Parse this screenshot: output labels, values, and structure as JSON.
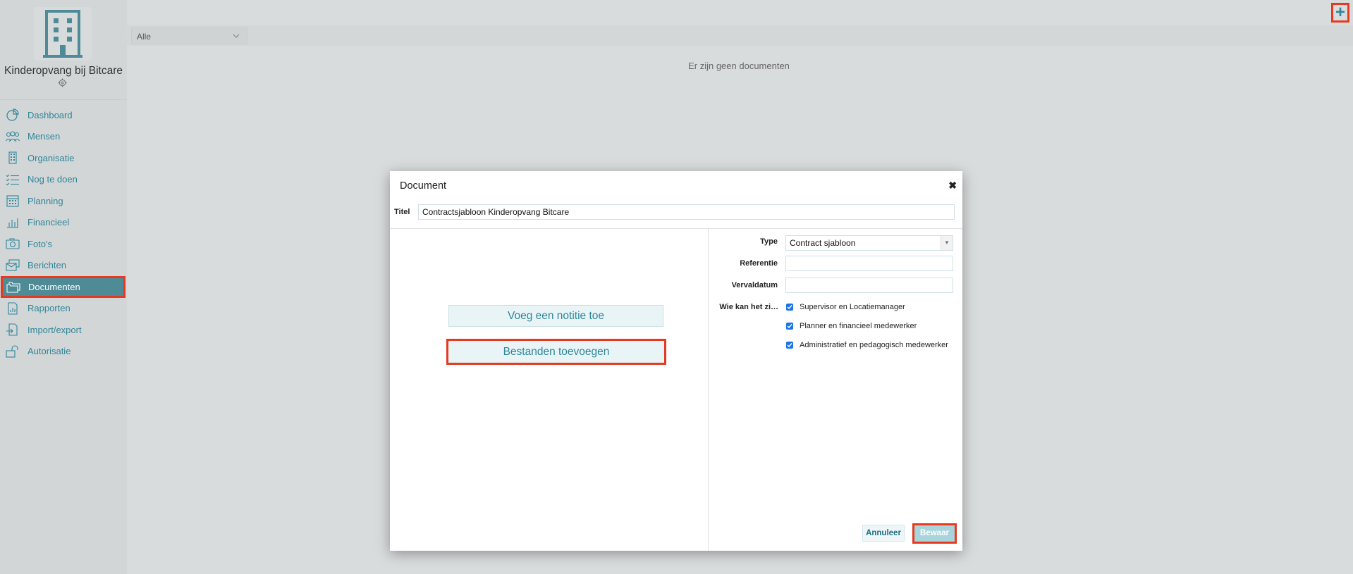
{
  "organization": {
    "name": "Kinderopvang bij Bitcare"
  },
  "sidebar": {
    "items": [
      {
        "label": "Dashboard",
        "icon": "chart-pie-icon"
      },
      {
        "label": "Mensen",
        "icon": "people-icon"
      },
      {
        "label": "Organisatie",
        "icon": "building-icon"
      },
      {
        "label": "Nog te doen",
        "icon": "checklist-icon"
      },
      {
        "label": "Planning",
        "icon": "calendar-icon"
      },
      {
        "label": "Financieel",
        "icon": "bar-chart-icon"
      },
      {
        "label": "Foto's",
        "icon": "camera-icon"
      },
      {
        "label": "Berichten",
        "icon": "messages-icon"
      },
      {
        "label": "Documenten",
        "icon": "folders-icon",
        "active": true
      },
      {
        "label": "Rapporten",
        "icon": "report-icon"
      },
      {
        "label": "Import/export",
        "icon": "import-export-icon"
      },
      {
        "label": "Autorisatie",
        "icon": "unlock-icon"
      }
    ]
  },
  "toolbar": {
    "add_label": "+"
  },
  "filter": {
    "selected": "Alle"
  },
  "main": {
    "empty_message": "Er zijn geen documenten"
  },
  "modal": {
    "title": "Document",
    "close": "✖",
    "title_label": "Titel",
    "title_value": "Contractsjabloon Kinderopvang Bitcare",
    "add_note": "Voeg een notitie toe",
    "add_files": "Bestanden toevoegen",
    "type_label": "Type",
    "type_value": "Contract sjabloon",
    "reference_label": "Referentie",
    "reference_value": "",
    "expiry_label": "Vervaldatum",
    "expiry_value": "",
    "visibility_label": "Wie kan het zi…",
    "visibility_options": [
      {
        "label": "Supervisor en Locatiemanager",
        "checked": true
      },
      {
        "label": "Planner en financieel medewerker",
        "checked": true
      },
      {
        "label": "Administratief en pedagogisch medewerker",
        "checked": true
      }
    ],
    "cancel": "Annuleer",
    "save": "Bewaar"
  },
  "colors": {
    "accent": "#2f8699",
    "active_nav": "#4e8b96",
    "highlight": "#e53a20"
  }
}
